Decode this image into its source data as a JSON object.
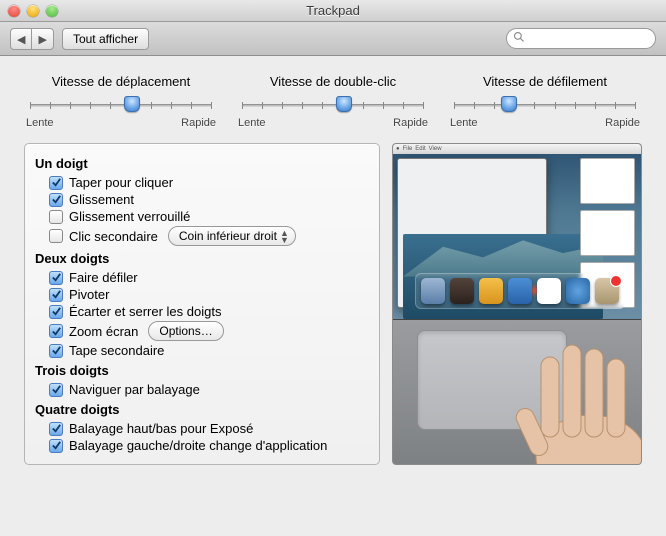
{
  "window": {
    "title": "Trackpad"
  },
  "toolbar": {
    "show_all": "Tout afficher",
    "search_placeholder": ""
  },
  "sliders": [
    {
      "title": "Vitesse de déplacement",
      "min_label": "Lente",
      "max_label": "Rapide",
      "position_pct": 56
    },
    {
      "title": "Vitesse de double-clic",
      "min_label": "Lente",
      "max_label": "Rapide",
      "position_pct": 56
    },
    {
      "title": "Vitesse de défilement",
      "min_label": "Lente",
      "max_label": "Rapide",
      "position_pct": 30
    }
  ],
  "sections": {
    "one_finger": {
      "heading": "Un doigt",
      "items": [
        {
          "label": "Taper pour cliquer",
          "checked": true
        },
        {
          "label": "Glissement",
          "checked": true
        },
        {
          "label": "Glissement verrouillé",
          "checked": false
        },
        {
          "label": "Clic secondaire",
          "checked": false,
          "dropdown": "Coin inférieur droit"
        }
      ]
    },
    "two_fingers": {
      "heading": "Deux doigts",
      "items": [
        {
          "label": "Faire défiler",
          "checked": true
        },
        {
          "label": "Pivoter",
          "checked": true
        },
        {
          "label": "Écarter et serrer les doigts",
          "checked": true
        },
        {
          "label": "Zoom écran",
          "checked": true,
          "button": "Options…"
        },
        {
          "label": "Tape secondaire",
          "checked": true
        }
      ]
    },
    "three_fingers": {
      "heading": "Trois doigts",
      "items": [
        {
          "label": "Naviguer par balayage",
          "checked": true
        }
      ]
    },
    "four_fingers": {
      "heading": "Quatre doigts",
      "items": [
        {
          "label": "Balayage haut/bas pour Exposé",
          "checked": true
        },
        {
          "label": "Balayage gauche/droite change d'application",
          "checked": true
        }
      ]
    }
  }
}
